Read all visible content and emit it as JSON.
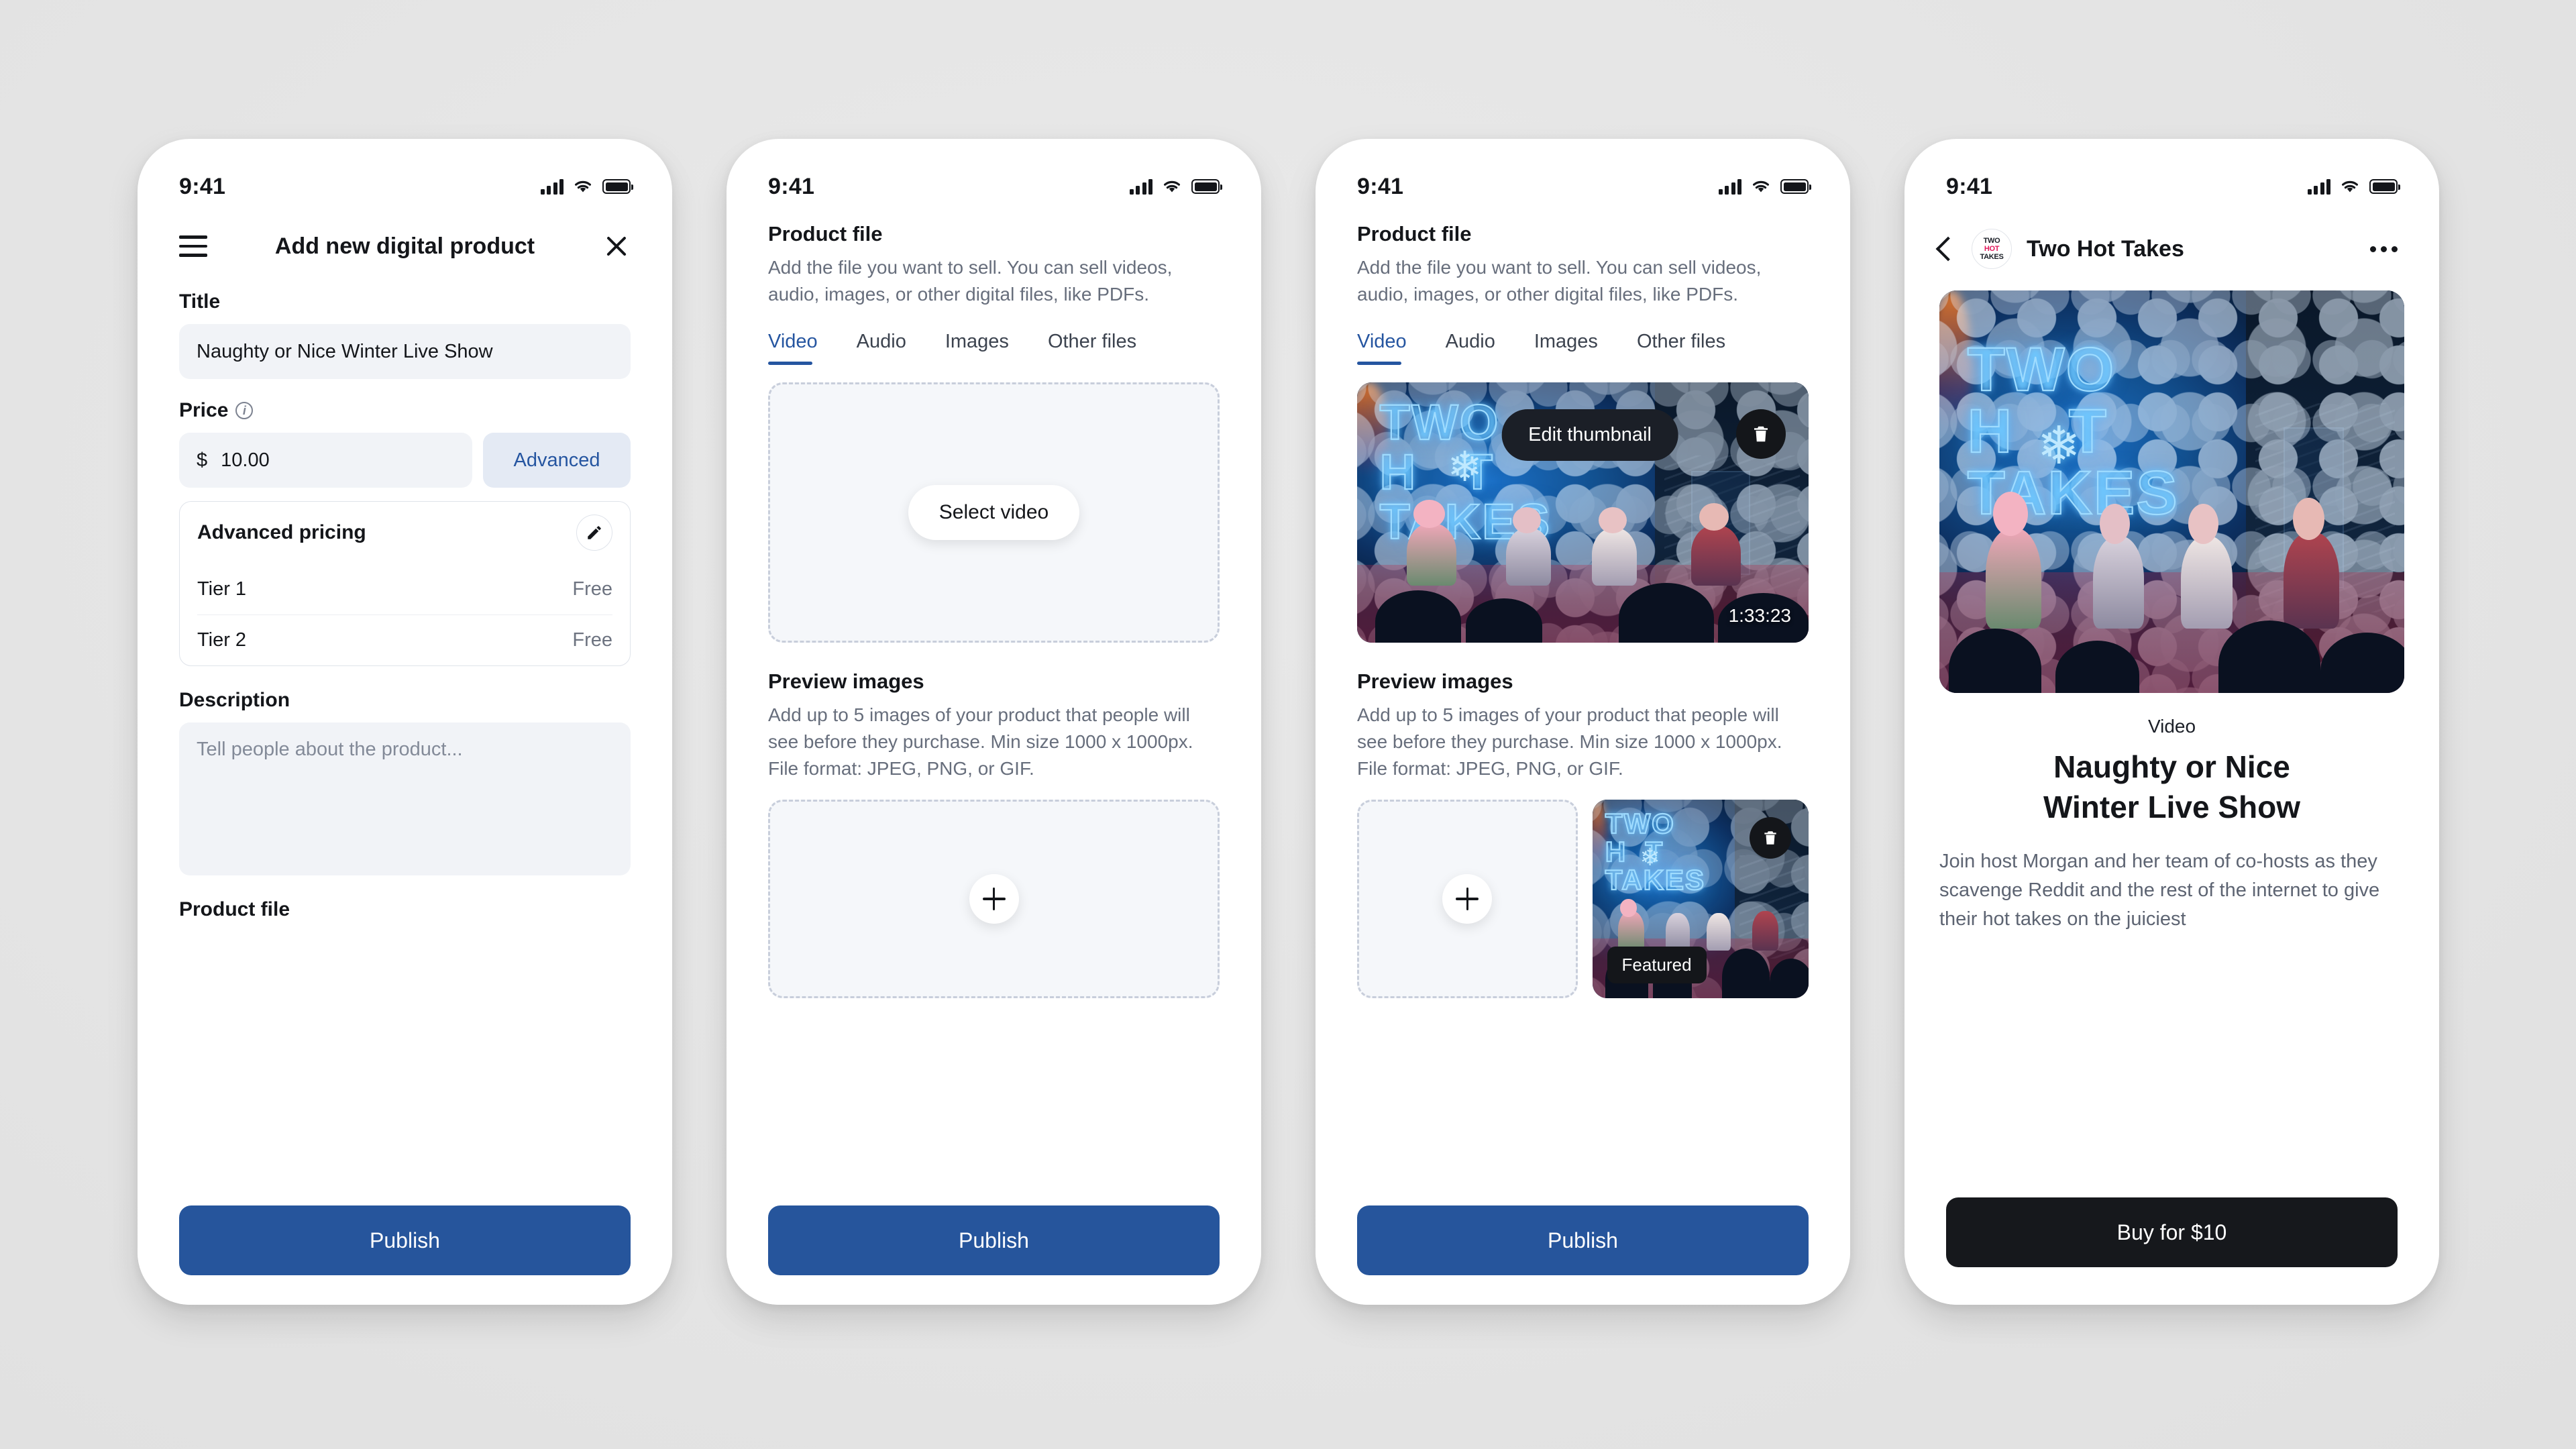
{
  "background_color": "#e7e7e7",
  "accent_blue": "#26559c",
  "link_blue": "#2555a0",
  "dark_button": "#16181c",
  "status_bar": {
    "time": "9:41",
    "signal_icon": "cellular-bars-icon",
    "wifi_icon": "wifi-icon",
    "battery_icon": "battery-icon"
  },
  "phone1": {
    "nav": {
      "menu_icon": "hamburger-menu-icon",
      "title": "Add new digital product",
      "close_icon": "close-x-icon"
    },
    "title_field": {
      "label": "Title",
      "value": "Naughty or Nice Winter Live Show"
    },
    "price": {
      "label": "Price",
      "info_icon": "info-circle-icon",
      "currency": "$",
      "value": "10.00",
      "advanced_button": "Advanced"
    },
    "advanced_pricing": {
      "heading": "Advanced pricing",
      "edit_icon": "pencil-edit-icon",
      "tiers": [
        {
          "name": "Tier 1",
          "price": "Free"
        },
        {
          "name": "Tier 2",
          "price": "Free"
        }
      ]
    },
    "description": {
      "label": "Description",
      "placeholder": "Tell people about the product..."
    },
    "product_file_label": "Product file",
    "publish_button": "Publish"
  },
  "phone2": {
    "product_file": {
      "heading": "Product file",
      "description": "Add the file you want to sell. You can sell videos, audio, images, or other digital files, like PDFs.",
      "tabs": [
        {
          "label": "Video",
          "active": true
        },
        {
          "label": "Audio",
          "active": false
        },
        {
          "label": "Images",
          "active": false
        },
        {
          "label": "Other files",
          "active": false
        }
      ],
      "select_button": "Select video"
    },
    "preview_images": {
      "heading": "Preview images",
      "description": "Add up to 5 images of your product that people will see before they purchase. Min size 1000 x 1000px. File format: JPEG, PNG, or GIF.",
      "add_icon": "plus-icon"
    },
    "publish_button": "Publish"
  },
  "phone3": {
    "product_file": {
      "heading": "Product file",
      "description": "Add the file you want to sell. You can sell videos, audio, images, or other digital files, like PDFs.",
      "tabs": [
        {
          "label": "Video",
          "active": true
        },
        {
          "label": "Audio",
          "active": false
        },
        {
          "label": "Images",
          "active": false
        },
        {
          "label": "Other files",
          "active": false
        }
      ],
      "edit_thumbnail_button": "Edit thumbnail",
      "delete_icon": "trash-icon",
      "duration": "1:33:23",
      "thumbnail_text": "TWO HOT TAKES"
    },
    "preview_images": {
      "heading": "Preview images",
      "description": "Add up to 5 images of your product that people will see before they purchase. Min size 1000 x 1000px. File format: JPEG, PNG, or GIF.",
      "add_icon": "plus-icon",
      "uploaded": {
        "featured_badge": "Featured",
        "delete_icon": "trash-icon"
      }
    },
    "publish_button": "Publish"
  },
  "phone4": {
    "nav": {
      "back_icon": "chevron-left-icon",
      "avatar": "two-hot-takes-avatar",
      "avatar_line1": "TWO",
      "avatar_line2": "HOT",
      "avatar_line3": "TAKES",
      "title": "Two Hot Takes",
      "more_icon": "more-options-icon"
    },
    "hero_text": "TWO HOT TAKES",
    "kicker": "Video",
    "title_line1": "Naughty or Nice",
    "title_line2": "Winter Live Show",
    "body": "Join host Morgan and her team of co-hosts as they scavenge Reddit and the rest of the internet to give their hot takes on the juiciest",
    "buy_button": "Buy for $10"
  }
}
